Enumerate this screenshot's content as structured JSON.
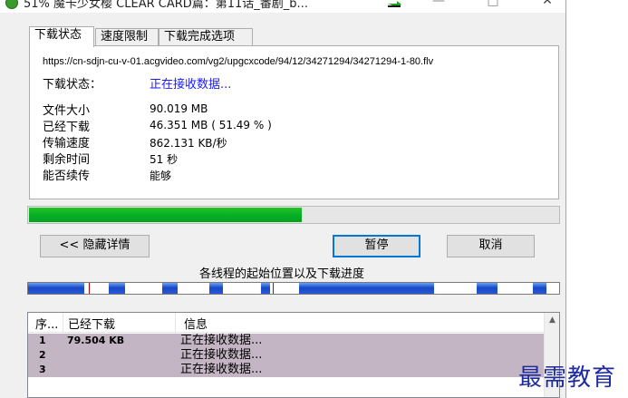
{
  "window": {
    "title": "51% 魔卡少女樱 CLEAR CARD篇：第11话_番剧_b..."
  },
  "tabs": [
    {
      "label": "下载状态"
    },
    {
      "label": "速度限制"
    },
    {
      "label": "下载完成选项"
    }
  ],
  "details": {
    "url": "https://cn-sdjn-cu-v-01.acgvideo.com/vg2/upgcxcode/94/12/34271294/34271294-1-80.flv",
    "status_label": "下载状态：",
    "status_value": "正在接收数据...",
    "file_size_label": "文件大小",
    "file_size_value": "90.019  MB",
    "downloaded_label": "已经下载",
    "downloaded_value": "46.351  MB  ( 51.49 % )",
    "speed_label": "传输速度",
    "speed_value": "862.131  KB/秒",
    "remaining_label": "剩余时间",
    "remaining_value": "51 秒",
    "resume_label": "能否续传",
    "resume_value": "能够"
  },
  "progress": {
    "fraction": 0.5149
  },
  "buttons": {
    "detail": "<< 隐藏详情",
    "pause": "暂停",
    "cancel": "取消"
  },
  "threads": {
    "caption": "各线程的起始位置以及下载进度",
    "segments": [
      {
        "start": 0.0,
        "end": 0.105
      },
      {
        "start": 0.152,
        "end": 0.183
      },
      {
        "start": 0.253,
        "end": 0.282
      },
      {
        "start": 0.342,
        "end": 0.368
      },
      {
        "start": 0.438,
        "end": 0.455
      },
      {
        "start": 0.51,
        "end": 0.765
      },
      {
        "start": 0.845,
        "end": 0.885
      },
      {
        "start": 0.95,
        "end": 0.975
      }
    ],
    "ticks": [
      0.115,
      0.46
    ]
  },
  "list": {
    "columns": [
      "序...",
      "已经下载",
      "信息"
    ],
    "rows": [
      {
        "idx": "1",
        "size": "79.504  KB",
        "info": "正在接收数据..."
      },
      {
        "idx": "2",
        "size": "",
        "info": "正在接收数据..."
      },
      {
        "idx": "3",
        "size": "",
        "info": "正在接收数据..."
      }
    ]
  },
  "watermark": "最需教育",
  "colors": {
    "progress_green": "#06b025",
    "thread_blue": "#1848c8",
    "row_highlight": "#c3b5c3",
    "status_blue": "#1a1aff",
    "watermark": "#1e2aa0"
  }
}
